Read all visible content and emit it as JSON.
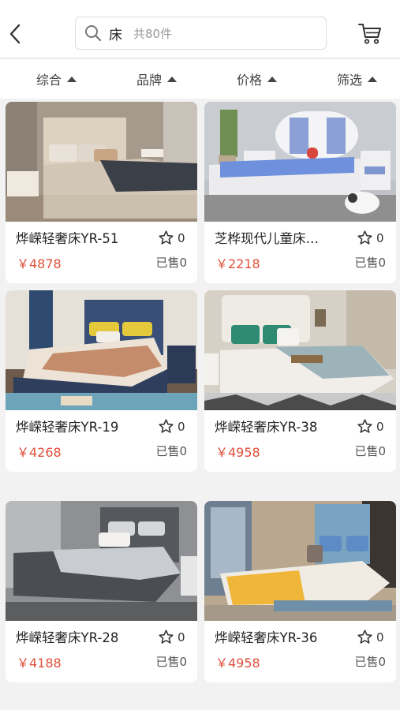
{
  "header": {
    "search_keyword": "床",
    "search_count": "共80件"
  },
  "sort_bar": [
    {
      "label": "综合"
    },
    {
      "label": "品牌"
    },
    {
      "label": "价格"
    },
    {
      "label": "筛选"
    }
  ],
  "products": [
    {
      "name": "烨嵘轻奢床YR-51",
      "favorites": "0",
      "price": "￥4878",
      "sold": "已售0"
    },
    {
      "name": "芝桦现代儿童床…",
      "favorites": "0",
      "price": "￥2218",
      "sold": "已售0"
    },
    {
      "name": "烨嵘轻奢床YR-19",
      "favorites": "0",
      "price": "￥4268",
      "sold": "已售0"
    },
    {
      "name": "烨嵘轻奢床YR-38",
      "favorites": "0",
      "price": "￥4958",
      "sold": "已售0"
    },
    {
      "name": "烨嵘轻奢床YR-28",
      "favorites": "0",
      "price": "￥4188",
      "sold": "已售0"
    },
    {
      "name": "烨嵘轻奢床YR-36",
      "favorites": "0",
      "price": "￥4958",
      "sold": "已售0"
    }
  ],
  "colors": {
    "price": "#e0503b",
    "background": "#f2f2f2"
  }
}
